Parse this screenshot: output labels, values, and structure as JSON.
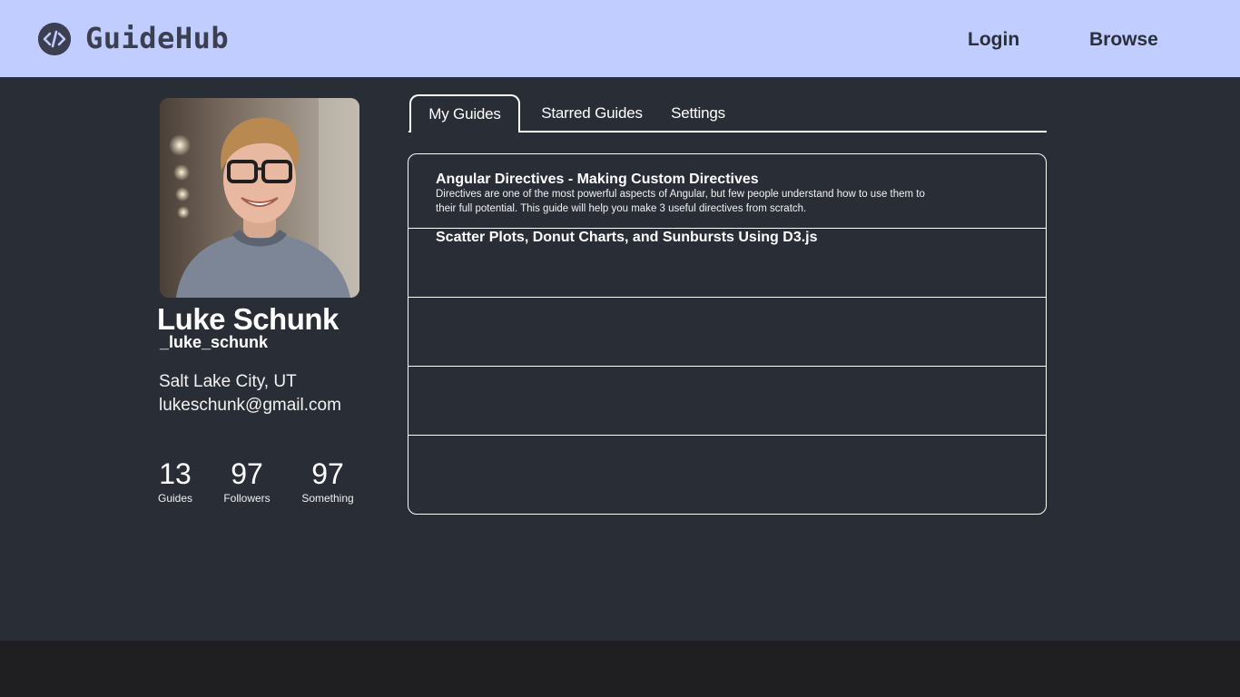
{
  "header": {
    "logo_icon": "code-icon",
    "brand": "GuideHub",
    "nav": [
      {
        "label": "Login"
      },
      {
        "label": "Browse"
      }
    ],
    "background": "#c1cdff"
  },
  "profile": {
    "name": "Luke Schunk",
    "handle": "_luke_schunk",
    "location": "Salt Lake City, UT",
    "email": "lukeschunk@gmail.com",
    "stats": [
      {
        "value": "13",
        "label": "Guides"
      },
      {
        "value": "97",
        "label": "Followers"
      },
      {
        "value": "97",
        "label": "Something"
      }
    ]
  },
  "tabs": [
    {
      "label": "My Guides",
      "active": true
    },
    {
      "label": "Starred Guides",
      "active": false
    },
    {
      "label": "Settings",
      "active": false
    }
  ],
  "guides": [
    {
      "title": "Angular Directives - Making Custom Directives",
      "description": "Directives are one of the most powerful aspects of Angular, but few people understand how to use them to their full potential. This guide will help you make 3 useful directives from scratch."
    },
    {
      "title": "Scatter Plots, Donut Charts, and Sunbursts Using D3.js",
      "description": ""
    },
    {
      "title": "",
      "description": ""
    },
    {
      "title": "",
      "description": ""
    },
    {
      "title": "",
      "description": ""
    }
  ],
  "colors": {
    "page_background": "#292d36",
    "footer": "#1f1f21",
    "logo_dark": "#3b3f4f"
  }
}
